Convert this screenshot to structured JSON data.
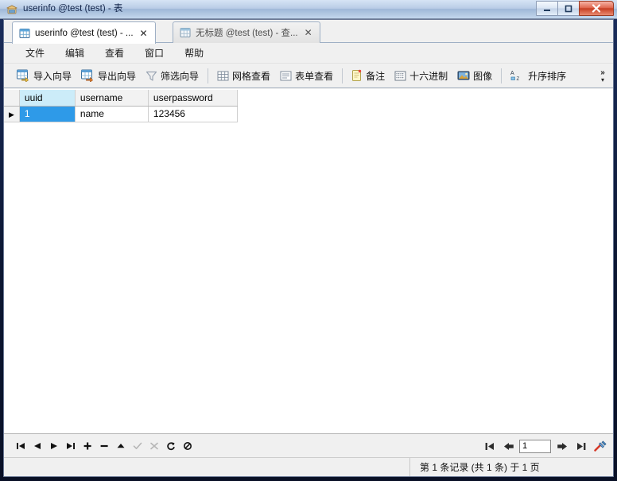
{
  "window": {
    "title": "userinfo @test (test) - 表",
    "app_icon": "table-window-icon",
    "controls": {
      "minimize": "minimize-button",
      "maximize": "maximize-button",
      "close": "close-button"
    }
  },
  "tabs": [
    {
      "label": "userinfo @test (test) - ...",
      "icon": "table-icon",
      "active": true,
      "close": "✕"
    },
    {
      "label": "无标题 @test (test) - 查...",
      "icon": "query-icon",
      "active": false,
      "close": "✕"
    }
  ],
  "menu": {
    "items": [
      {
        "label": "文件"
      },
      {
        "label": "编辑"
      },
      {
        "label": "查看"
      },
      {
        "label": "窗口"
      },
      {
        "label": "帮助"
      }
    ]
  },
  "toolbar": {
    "groups": [
      [
        {
          "label": "导入向导",
          "icon": "import-wizard-icon"
        },
        {
          "label": "导出向导",
          "icon": "export-wizard-icon"
        },
        {
          "label": "筛选向导",
          "icon": "filter-wizard-icon"
        }
      ],
      [
        {
          "label": "网格查看",
          "icon": "grid-view-icon"
        },
        {
          "label": "表单查看",
          "icon": "form-view-icon"
        }
      ],
      [
        {
          "label": "备注",
          "icon": "memo-icon"
        },
        {
          "label": "十六进制",
          "icon": "hex-icon"
        },
        {
          "label": "图像",
          "icon": "image-icon"
        }
      ],
      [
        {
          "label": "升序排序",
          "icon": "sort-asc-icon"
        }
      ]
    ],
    "overflow": {
      "chevron": "»",
      "arrow": "▾"
    }
  },
  "grid": {
    "columns": [
      {
        "key": "uuid",
        "label": "uuid",
        "selected": true
      },
      {
        "key": "username",
        "label": "username",
        "selected": false
      },
      {
        "key": "userpassword",
        "label": "userpassword",
        "selected": false
      }
    ],
    "rows": [
      {
        "marker": "▶",
        "current": true,
        "cells": [
          {
            "value": "1",
            "selected": true
          },
          {
            "value": "name",
            "selected": false
          },
          {
            "value": "123456",
            "selected": false
          }
        ]
      }
    ]
  },
  "navbar": {
    "buttons": [
      {
        "name": "first-record-button",
        "icon": "first-icon",
        "enabled": true
      },
      {
        "name": "previous-record-button",
        "icon": "prev-icon",
        "enabled": true
      },
      {
        "name": "next-record-button",
        "icon": "next-icon",
        "enabled": true
      },
      {
        "name": "last-record-button",
        "icon": "last-icon",
        "enabled": true
      },
      {
        "name": "add-record-button",
        "icon": "plus-icon",
        "enabled": true
      },
      {
        "name": "delete-record-button",
        "icon": "minus-icon",
        "enabled": true
      },
      {
        "name": "edit-record-button",
        "icon": "up-triangle-icon",
        "enabled": true
      },
      {
        "name": "apply-change-button",
        "icon": "check-icon",
        "enabled": false
      },
      {
        "name": "discard-change-button",
        "icon": "cross-icon",
        "enabled": false
      },
      {
        "name": "refresh-button",
        "icon": "refresh-icon",
        "enabled": true
      },
      {
        "name": "stop-button",
        "icon": "stop-icon",
        "enabled": true
      }
    ],
    "pagination": {
      "first_page": "first-page-icon",
      "prev_page": "prev-page-icon",
      "page_value": "1",
      "next_page": "next-page-icon",
      "last_page": "last-page-icon",
      "settings": "tools-icon"
    }
  },
  "status": {
    "text": "第 1 条记录 (共 1 条) 于 1 页"
  },
  "colors": {
    "selection_blue": "#2e9ae8",
    "header_selected": "#ccecf9",
    "toolbar_bg": "#f0f0f0",
    "close_red": "#c63f24"
  }
}
